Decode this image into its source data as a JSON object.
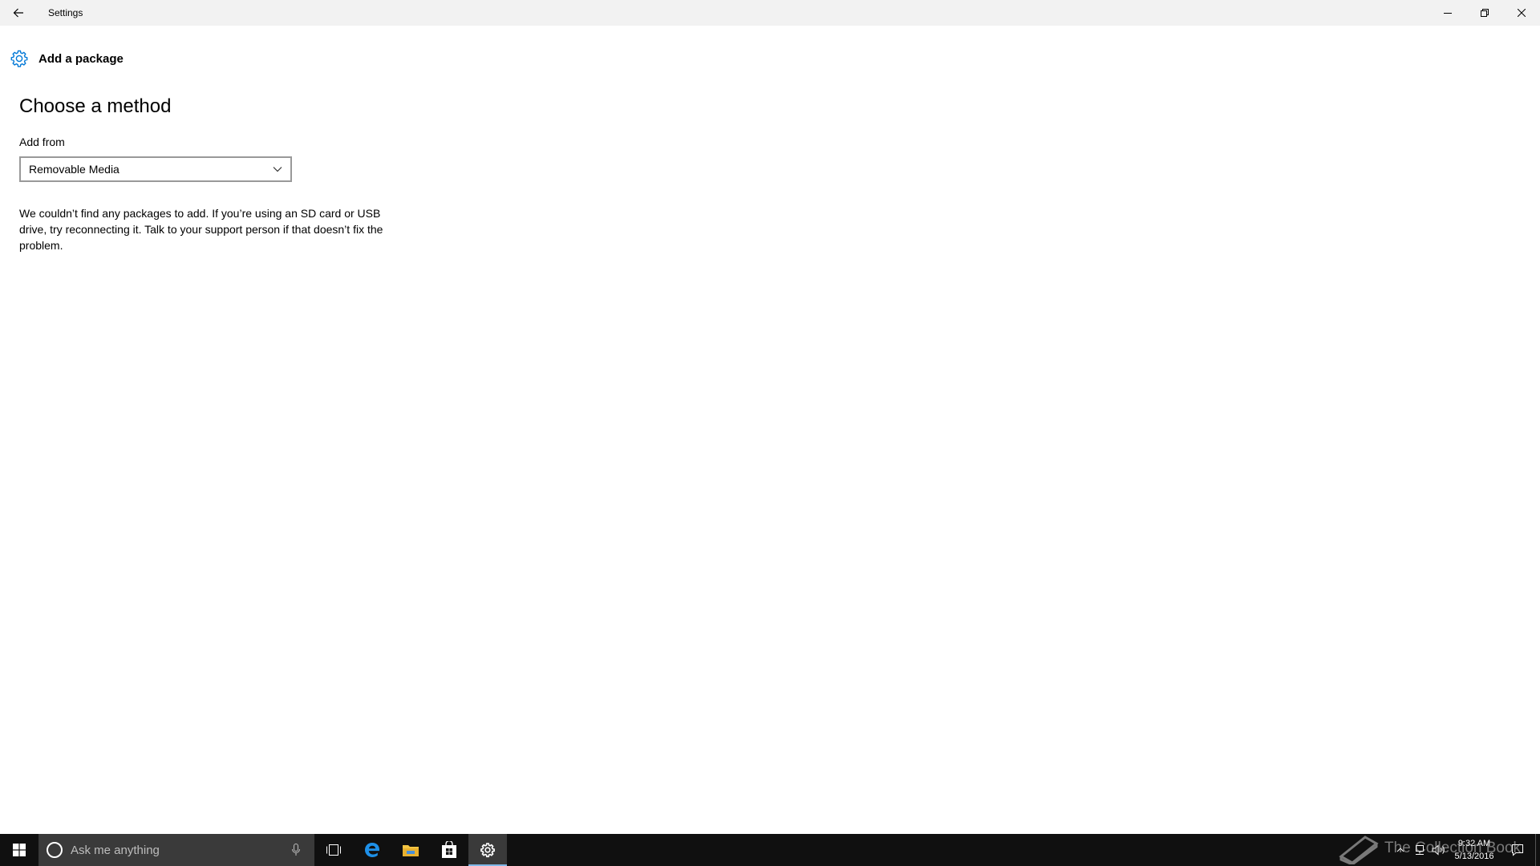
{
  "window": {
    "title": "Settings",
    "back_label": "Back",
    "minimize_label": "Minimize",
    "restore_label": "Restore",
    "close_label": "Close"
  },
  "page": {
    "header_title": "Add a package",
    "section_title": "Choose a method",
    "add_from_label": "Add from",
    "add_from_value": "Removable Media",
    "message": "We couldn’t find any packages to add. If you’re using an SD card or USB drive, try reconnecting it. Talk to your support person if that doesn’t fix the problem."
  },
  "taskbar": {
    "search_placeholder": "Ask me anything",
    "time": "9:32 AM",
    "date": "5/13/2016",
    "pinned": [
      "task-view",
      "edge",
      "file-explorer",
      "store",
      "settings"
    ],
    "active_app": "settings"
  },
  "watermark": {
    "text": "The Collection Book"
  },
  "colors": {
    "accent": "#0078d7",
    "titlebar_bg": "#f2f2f2",
    "taskbar_bg": "#101010",
    "search_bg": "#3a3a3a",
    "active_indicator": "#7fb8e8"
  }
}
